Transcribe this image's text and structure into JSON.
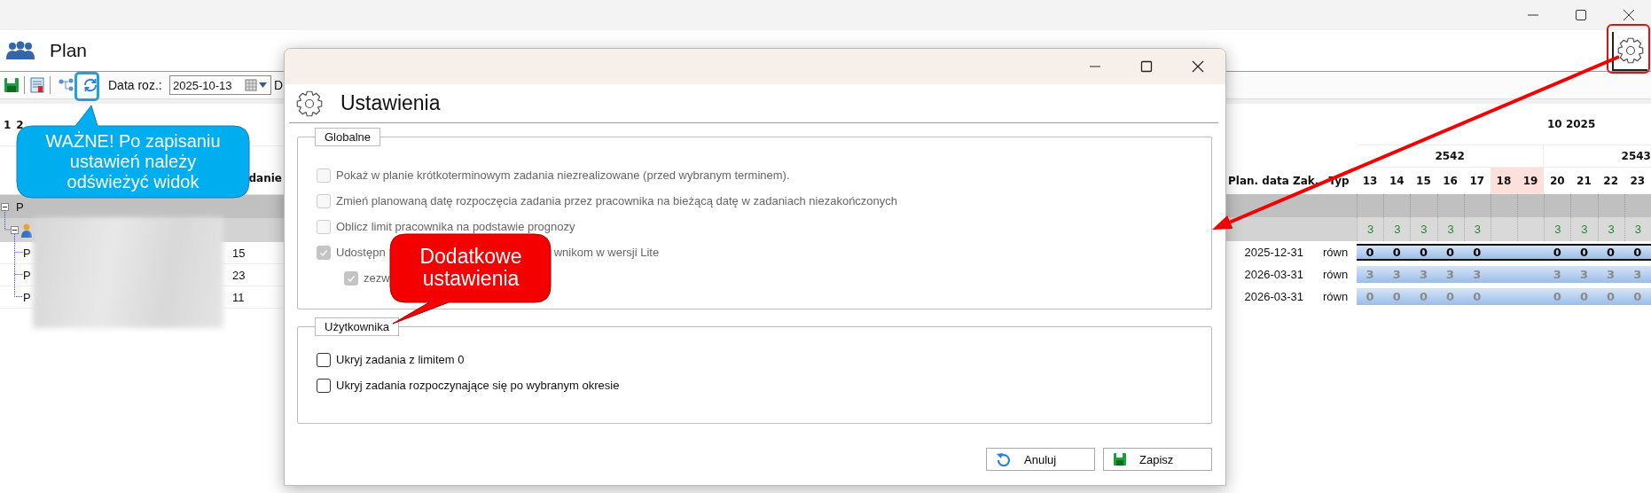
{
  "header": {
    "title": "Plan"
  },
  "toolbar": {
    "date_label": "Data roz.:",
    "date_value": "2025-10-13",
    "next_label": "D"
  },
  "left_grid": {
    "levels": [
      "1",
      "2"
    ],
    "column_header": "danie",
    "group_row": {
      "label": "P",
      "expanded": true
    },
    "sub_row": {
      "expanded": true
    },
    "rows": [
      {
        "label": "P",
        "number": "15"
      },
      {
        "label": "P",
        "number": "23"
      },
      {
        "label": "P",
        "number": "11"
      }
    ]
  },
  "right_grid": {
    "month": "10 2025",
    "columns": [
      "Plan. data Zak.",
      "Typ"
    ],
    "weeks": [
      {
        "label": "2542",
        "days": [
          {
            "label": "13",
            "weekend": false
          },
          {
            "label": "14",
            "weekend": false
          },
          {
            "label": "15",
            "weekend": false
          },
          {
            "label": "16",
            "weekend": false
          },
          {
            "label": "17",
            "weekend": false
          },
          {
            "label": "18",
            "weekend": true
          },
          {
            "label": "19",
            "weekend": true
          }
        ]
      },
      {
        "label": "2543",
        "days": [
          {
            "label": "20",
            "weekend": false
          },
          {
            "label": "21",
            "weekend": false
          },
          {
            "label": "22",
            "weekend": false
          },
          {
            "label": "23",
            "weekend": false
          }
        ]
      }
    ],
    "limits": [
      "3",
      "3",
      "3",
      "3",
      "3",
      "3",
      "3",
      "3",
      "3"
    ],
    "rows": [
      {
        "date": "2025-12-31",
        "type": "równ",
        "highlighted": true,
        "values": [
          "0",
          "0",
          "0",
          "0",
          "0",
          "0",
          "0",
          "0",
          "0"
        ]
      },
      {
        "date": "2026-03-31",
        "type": "równ",
        "highlighted": false,
        "values": [
          "3",
          "3",
          "3",
          "3",
          "3",
          "3",
          "3",
          "3",
          "3"
        ]
      },
      {
        "date": "2026-03-31",
        "type": "równ",
        "highlighted": false,
        "values": [
          "0",
          "0",
          "0",
          "0",
          "0",
          "0",
          "0",
          "0",
          "0"
        ]
      }
    ]
  },
  "dialog": {
    "title": "Ustawienia",
    "groups": [
      {
        "title": "Globalne",
        "options": [
          {
            "label": "Pokaż w planie krótkoterminowym zadania niezrealizowane (przed wybranym terminem).",
            "checked": false,
            "disabled": true
          },
          {
            "label": "Zmień planowaną datę rozpoczęcia zadania przez pracownika na bieżącą datę w zadaniach niezakończonych",
            "checked": false,
            "disabled": true
          },
          {
            "label": "Oblicz limit pracownika na podstawie prognozy",
            "checked": false,
            "disabled": true
          },
          {
            "label": "Udostępn",
            "label_end": "wnikom w wersji Lite",
            "checked": true,
            "disabled": true,
            "children": [
              {
                "label": "zezw",
                "checked": true,
                "disabled": true
              }
            ]
          }
        ]
      },
      {
        "title": "Użytkownika",
        "options": [
          {
            "label": "Ukryj zadania z limitem 0",
            "checked": false,
            "disabled": false
          },
          {
            "label": "Ukryj zadania rozpoczynające się po wybranym okresie",
            "checked": false,
            "disabled": false
          }
        ]
      }
    ],
    "buttons": [
      {
        "label": "Anuluj",
        "kind": "cancel"
      },
      {
        "label": "Zapisz",
        "kind": "save"
      }
    ]
  },
  "annotations": {
    "refresh_callout": "WAŻNE! Po zapisaniu\nustawień należy\nodświeżyć widok",
    "settings_callout": "Dodatkowe\nustawienia"
  }
}
